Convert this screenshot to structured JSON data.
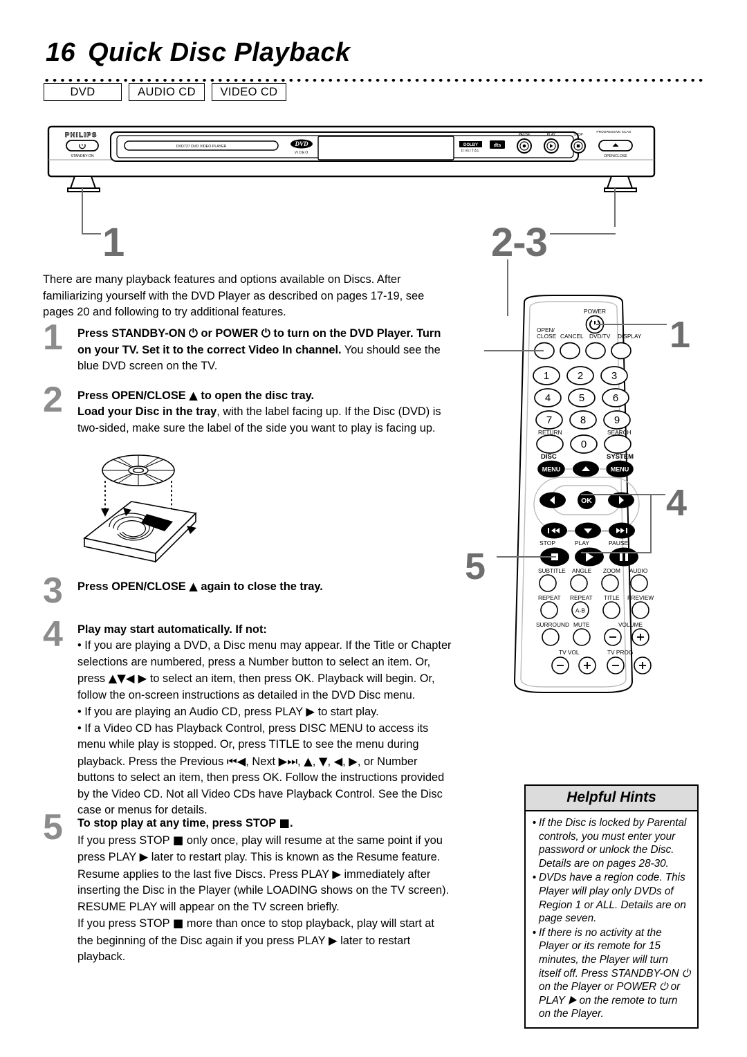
{
  "header": {
    "page_number": "16",
    "title": "Quick Disc Playback",
    "media_tags": [
      "DVD",
      "AUDIO CD",
      "VIDEO CD"
    ]
  },
  "player": {
    "brand": "PHILIPS",
    "standby_label": "STANDBY-ON",
    "tray_label": "DVD727   DVD VIDEO PLAYER",
    "dvd_logo": "DVD",
    "dvd_logo_sub": "VIDEO",
    "dolby_logo": "DOLBY",
    "dolby_logo_sub": "DIGITAL",
    "dts_logo": "DTS",
    "buttons": [
      "PAUSE",
      "PLAY",
      "STOP"
    ],
    "open_close_label": "OPEN/CLOSE",
    "progressive_scan": "PROGRESSIVE SCAN"
  },
  "callouts": {
    "player_left": "1",
    "player_right": "2-3",
    "remote_power": "1",
    "remote_nav": "4",
    "remote_stop": "5"
  },
  "intro": "There are many playback features and options available on Discs. After familiarizing yourself with the DVD Player as described on pages 17-19, see pages 20 and following to try additional features.",
  "steps": [
    {
      "number": "1",
      "html": "<b>Press STANDBY-ON <span class='glyph'>⏻</span> or POWER <span class='glyph'>⏻</span> to turn on the DVD Player.  Turn on your TV.  Set it to the correct Video In channel.</b> You should see the blue DVD screen on the TV."
    },
    {
      "number": "2",
      "html": "<b>Press OPEN/CLOSE <span class='glyph'>▲</span> to open the disc tray.</b><br><b>Load your Disc in the tray</b>, with the label facing up. If the Disc (DVD) is two-sided, make sure the label of the side you want to play is facing up."
    },
    {
      "number": "3",
      "html": "<b>Press OPEN/CLOSE <span class='glyph'>▲</span> again to close the tray.</b>"
    },
    {
      "number": "4",
      "html": "<b>Play may start automatically. If not:</b><br>• If you are playing a DVD, a Disc menu may appear. If the Title or Chapter selections are numbered, press a Number button to select an item. Or, press <span class='glyph'>▲▼◀ ▶</span> to select an item, then press OK. Playback will begin. Or, follow the on-screen instructions as detailed in the DVD Disc menu.<br>• If you are playing an Audio CD, press PLAY <span class='glyph'>▶</span> to start play.<br>• If a Video CD has Playback Control, press DISC MENU to access its menu while play is stopped. Or, press TITLE to see the menu during playback.  Press the Previous <span class='glyph'>⏮◀</span>, Next <span class='glyph'>▶⏭</span>, <span class='glyph'>▲</span>, <span class='glyph'>▼</span>, <span class='glyph'>◀</span>, <span class='glyph'>▶</span>, or Number buttons to select an item, then press OK. Follow the instructions provided by the Video CD. Not all Video CDs have Playback Control. See the Disc case or menus for details."
    },
    {
      "number": "5",
      "html": "<b>To stop play at any time, press STOP <span class='glyph'>■</span>.</b><br>If you press STOP <span class='glyph'>■</span> only once, play will resume at the same point if you press PLAY <span class='glyph'>▶</span> later to restart play. This is known as the Resume feature.<br>Resume applies to the last five Discs. Press PLAY <span class='glyph'>▶</span> immediately after inserting the Disc in the Player (while LOADING shows on the TV screen). RESUME PLAY will appear on the TV screen briefly.<br>If you press STOP <span class='glyph'>■</span> more than once to stop playback, play will start at the beginning of the Disc again if you press PLAY <span class='glyph'>▶</span> later to restart playback."
    }
  ],
  "remote": {
    "power_label": "POWER",
    "row_top": [
      "OPEN/\nCLOSE",
      "CANCEL",
      "DVD/TV",
      "DISPLAY"
    ],
    "keypad": [
      "1",
      "2",
      "3",
      "4",
      "5",
      "6",
      "7",
      "8",
      "9"
    ],
    "return_label": "RETURN",
    "zero_label": "0",
    "search_label": "SEARCH",
    "disc_label": "DISC",
    "system_label": "SYSTEM",
    "menu_label": "MENU",
    "ok_label": "OK",
    "transport_labels": [
      "STOP",
      "PLAY",
      "PAUSE"
    ],
    "row_subtitle": [
      "SUBTITLE",
      "ANGLE",
      "ZOOM",
      "AUDIO"
    ],
    "row_repeat": [
      "REPEAT",
      "REPEAT",
      "TITLE",
      "PREVIEW"
    ],
    "repeat_ab": "A-B",
    "row_surround": [
      "SURROUND",
      "MUTE"
    ],
    "volume_label": "VOLUME",
    "tv_vol_label": "TV VOL",
    "tv_prog_label": "TV PROG",
    "minus": "−",
    "plus": "+"
  },
  "hints": {
    "title": "Helpful Hints",
    "bullet": "•",
    "items": [
      "If the Disc is locked by Parental controls, you must enter your password or unlock the Disc. Details are on pages 28-30.",
      "DVDs have a region code. This Player will play only DVDs of Region 1 or ALL. Details are on page seven.",
      "If there is no activity at the Player or its remote for 15 minutes, the Player will turn itself off. Press STANDBY-ON ⏻ on the Player or POWER ⏻ or PLAY ▶ on the remote to turn on the Player."
    ]
  },
  "colors": {
    "callout_gray": "#6e6e6e",
    "step_gray": "#8c8c8c",
    "hint_header_bg": "#dcdcdc"
  }
}
